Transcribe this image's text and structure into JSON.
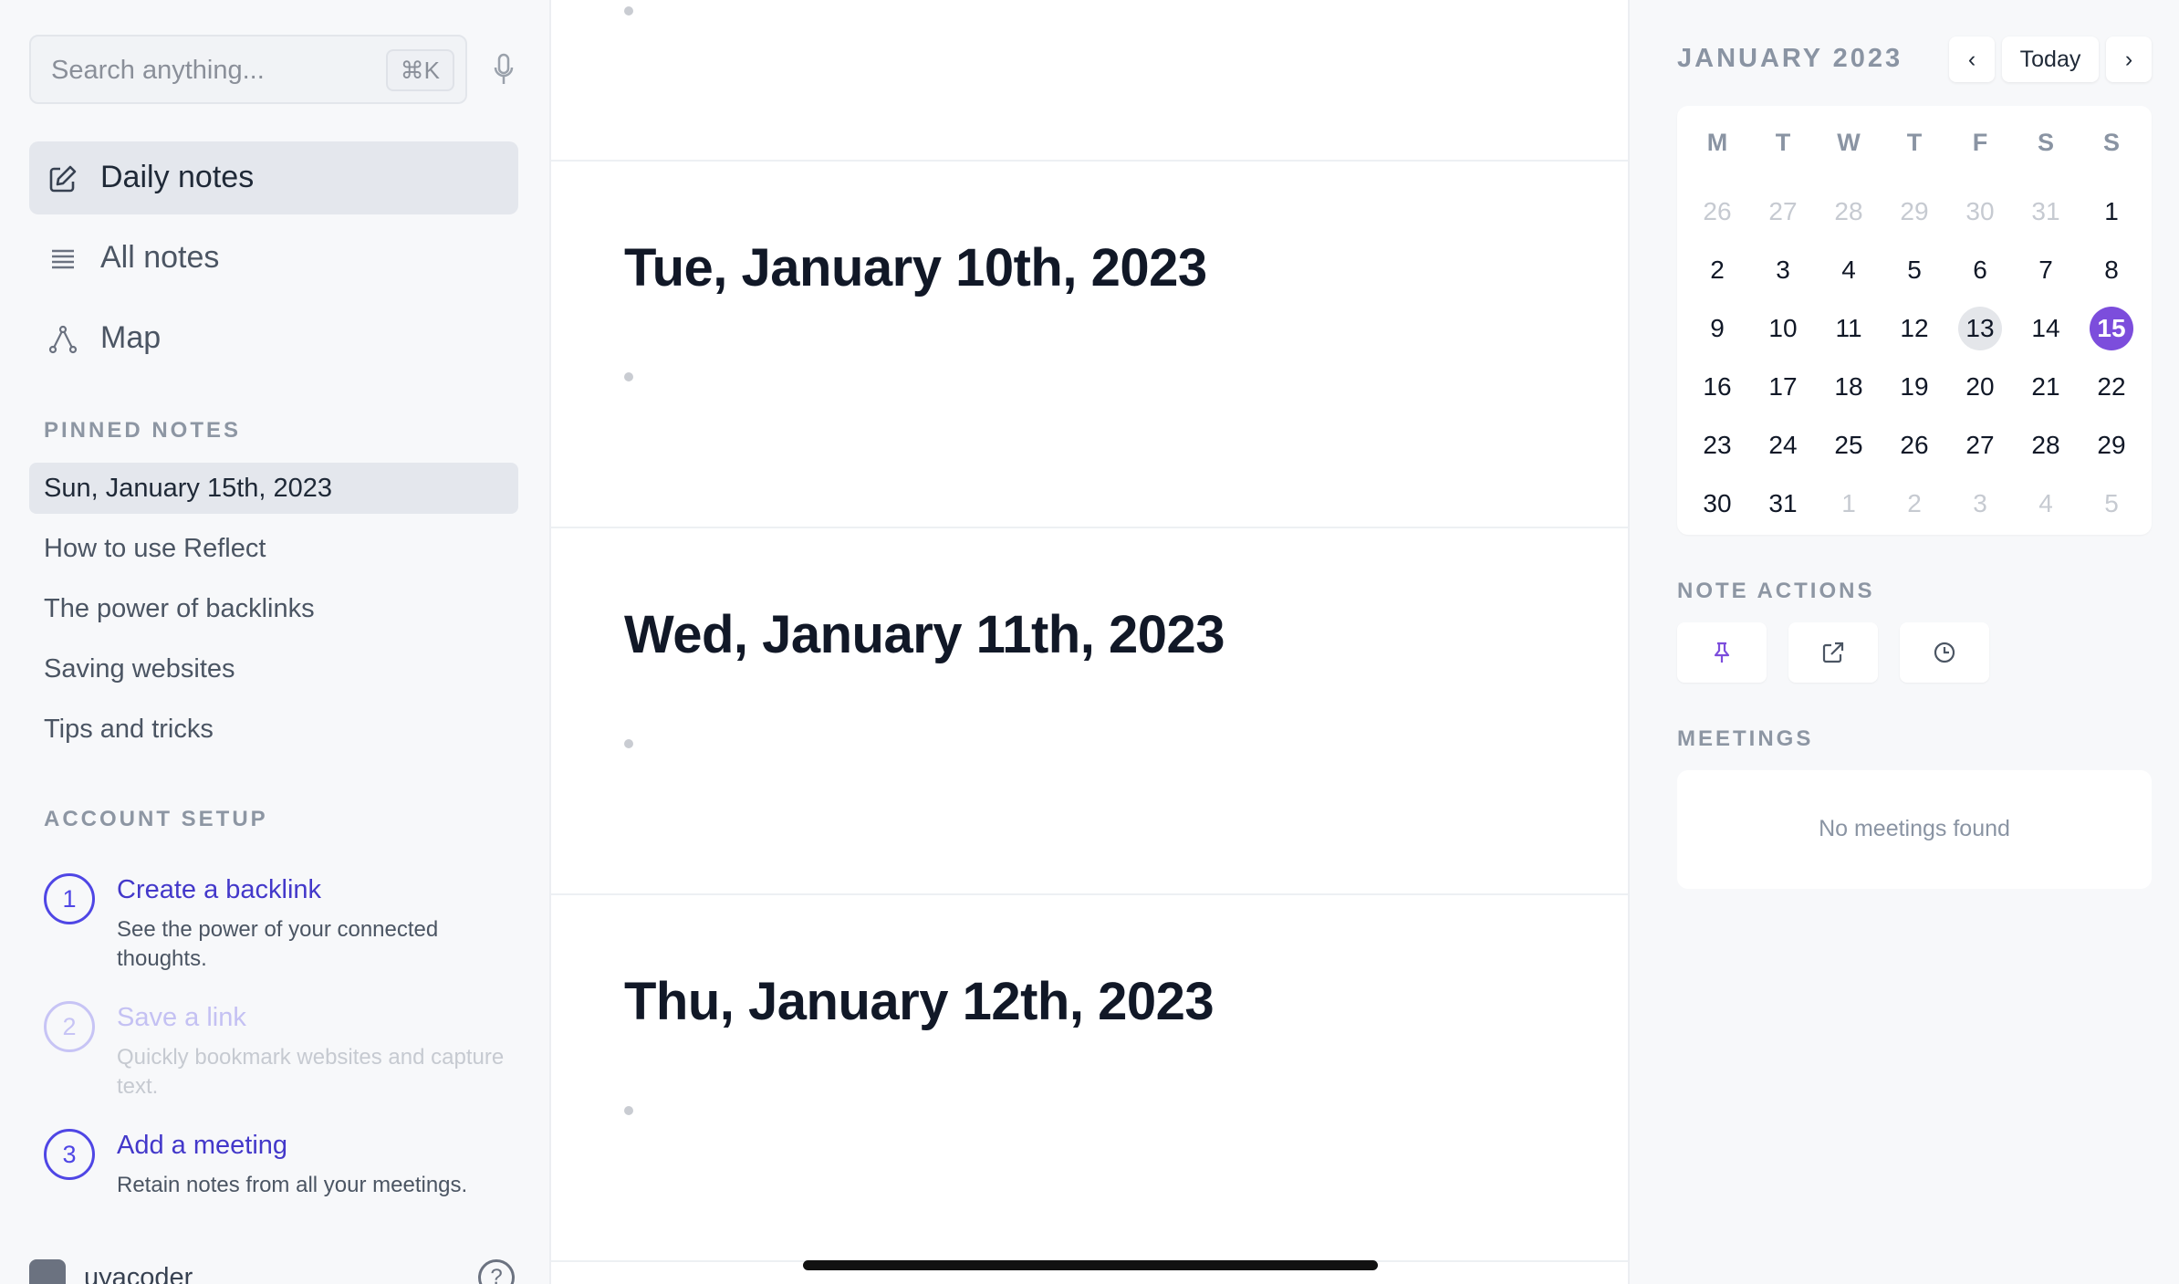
{
  "search": {
    "placeholder": "Search anything...",
    "shortcut": "⌘K"
  },
  "nav": [
    {
      "label": "Daily notes",
      "icon": "edit-icon"
    },
    {
      "label": "All notes",
      "icon": "list-icon"
    },
    {
      "label": "Map",
      "icon": "graph-icon"
    }
  ],
  "pinned": {
    "title": "PINNED NOTES",
    "items": [
      "Sun, January 15th, 2023",
      "How to use Reflect",
      "The power of backlinks",
      "Saving websites",
      "Tips and tricks"
    ]
  },
  "setup": {
    "title": "ACCOUNT SETUP",
    "steps": [
      {
        "num": "1",
        "title": "Create a backlink",
        "desc": "See the power of your connected thoughts."
      },
      {
        "num": "2",
        "title": "Save a link",
        "desc": "Quickly bookmark websites and capture text."
      },
      {
        "num": "3",
        "title": "Add a meeting",
        "desc": "Retain notes from all your meetings."
      }
    ]
  },
  "user": {
    "name": "uyacoder",
    "help": "?"
  },
  "days": [
    {
      "title": "Tue, January 10th, 2023"
    },
    {
      "title": "Wed, January 11th, 2023"
    },
    {
      "title": "Thu, January 12th, 2023"
    }
  ],
  "calendar": {
    "month": "JANUARY 2023",
    "prev": "‹",
    "today_label": "Today",
    "next": "›",
    "weekdays": [
      "M",
      "T",
      "W",
      "T",
      "F",
      "S",
      "S"
    ],
    "weeks": [
      [
        "26",
        "27",
        "28",
        "29",
        "30",
        "31",
        "1"
      ],
      [
        "2",
        "3",
        "4",
        "5",
        "6",
        "7",
        "8"
      ],
      [
        "9",
        "10",
        "11",
        "12",
        "13",
        "14",
        "15"
      ],
      [
        "16",
        "17",
        "18",
        "19",
        "20",
        "21",
        "22"
      ],
      [
        "23",
        "24",
        "25",
        "26",
        "27",
        "28",
        "29"
      ],
      [
        "30",
        "31",
        "1",
        "2",
        "3",
        "4",
        "5"
      ]
    ],
    "today": "13",
    "selected": "15",
    "accent": "#7c4ddc"
  },
  "note_actions": {
    "title": "NOTE ACTIONS",
    "buttons": [
      "pin-icon",
      "external-link-icon",
      "clock-icon"
    ]
  },
  "meetings": {
    "title": "MEETINGS",
    "empty": "No meetings found"
  }
}
